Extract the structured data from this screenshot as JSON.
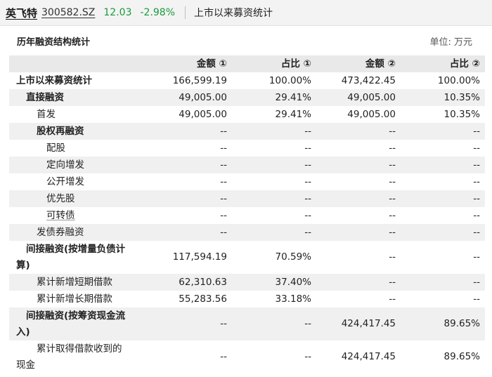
{
  "header": {
    "stock_name": "英飞特",
    "stock_code": "300582.SZ",
    "price": "12.03",
    "change": "-2.98%",
    "page_title": "上市以来募资统计"
  },
  "section": {
    "title": "历年融资结构统计",
    "unit": "单位: 万元"
  },
  "columns": [
    "",
    "金额 ①",
    "占比 ①",
    "金额 ②",
    "占比 ②"
  ],
  "rows": [
    {
      "label": "上市以来募资统计",
      "v": [
        "166,599.19",
        "100.00%",
        "473,422.45",
        "100.00%"
      ]
    },
    {
      "label": "直接融资",
      "v": [
        "49,005.00",
        "29.41%",
        "49,005.00",
        "10.35%"
      ]
    },
    {
      "label": "首发",
      "v": [
        "49,005.00",
        "29.41%",
        "49,005.00",
        "10.35%"
      ]
    },
    {
      "label": "股权再融资",
      "v": [
        "--",
        "--",
        "--",
        "--"
      ]
    },
    {
      "label": "配股",
      "v": [
        "--",
        "--",
        "--",
        "--"
      ]
    },
    {
      "label": "定向增发",
      "v": [
        "--",
        "--",
        "--",
        "--"
      ]
    },
    {
      "label": "公开增发",
      "v": [
        "--",
        "--",
        "--",
        "--"
      ]
    },
    {
      "label": "优先股",
      "v": [
        "--",
        "--",
        "--",
        "--"
      ]
    },
    {
      "label": "可转债",
      "v": [
        "--",
        "--",
        "--",
        "--"
      ]
    },
    {
      "label": "发债券融资",
      "v": [
        "--",
        "--",
        "--",
        "--"
      ]
    },
    {
      "label_l1": "间接融资(按增量负债计",
      "label_l2": "算)",
      "v": [
        "117,594.19",
        "70.59%",
        "--",
        "--"
      ]
    },
    {
      "label": "累计新增短期借款",
      "v": [
        "62,310.63",
        "37.40%",
        "--",
        "--"
      ]
    },
    {
      "label": "累计新增长期借款",
      "v": [
        "55,283.56",
        "33.18%",
        "--",
        "--"
      ]
    },
    {
      "label_l1": "间接融资(按筹资现金流",
      "label_l2": "入)",
      "v": [
        "--",
        "--",
        "424,417.45",
        "89.65%"
      ]
    },
    {
      "label_l1": "累计取得借款收到的",
      "label_l2": "现金",
      "v": [
        "--",
        "--",
        "424,417.45",
        "89.65%"
      ]
    }
  ]
}
